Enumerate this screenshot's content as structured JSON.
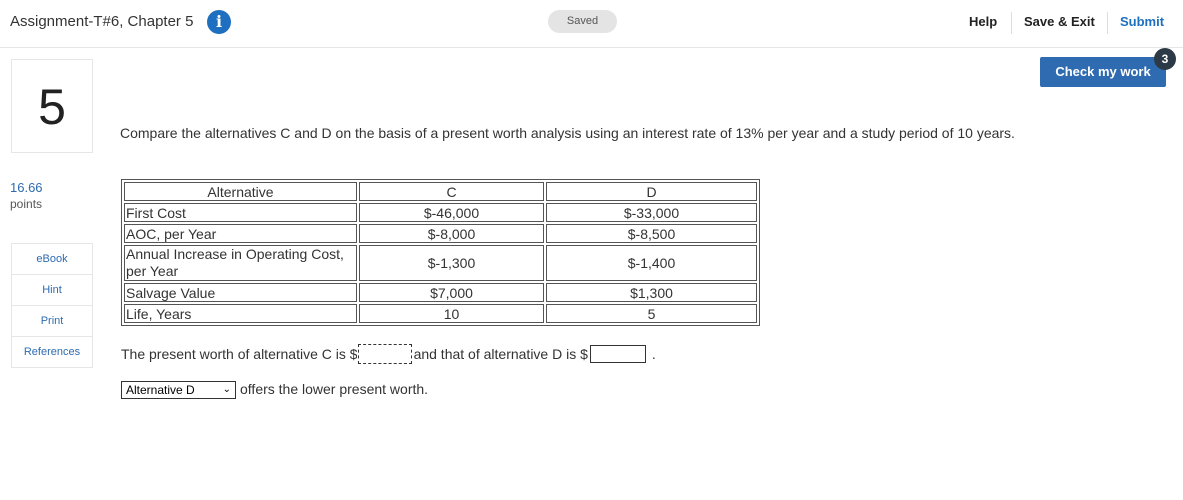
{
  "header": {
    "title": "Assignment-T#6, Chapter 5",
    "info_icon": "info-icon",
    "status": "Saved",
    "help": "Help",
    "save_exit": "Save & Exit",
    "submit": "Submit"
  },
  "check_work": {
    "label": "Check my work",
    "badge": "3"
  },
  "question": {
    "number": "5",
    "points_value": "16.66",
    "points_label": "points",
    "text": "Compare the alternatives C and D on the basis of a present worth analysis using an interest rate of 13% per year and a study period of 10 years."
  },
  "sidebar": {
    "items": [
      {
        "label": "eBook"
      },
      {
        "label": "Hint"
      },
      {
        "label": "Print"
      },
      {
        "label": "References"
      }
    ]
  },
  "table": {
    "headers": [
      "Alternative",
      "C",
      "D"
    ],
    "rows": [
      [
        "First Cost",
        "$-46,000",
        "$-33,000"
      ],
      [
        "AOC, per Year",
        "$-8,000",
        "$-8,500"
      ],
      [
        "Annual Increase in Operating Cost, per Year",
        "$-1,300",
        "$-1,400"
      ],
      [
        "Salvage Value",
        "$7,000",
        "$1,300"
      ],
      [
        "Life, Years",
        "10",
        "5"
      ]
    ]
  },
  "answers": {
    "pw_c_prefix": "The present worth of alternative C is $",
    "pw_c_value": "",
    "pw_d_prefix": "and that of alternative D is $",
    "pw_d_value": "",
    "end": ".",
    "choice_selected": "Alternative D",
    "choice_suffix": "offers the lower present worth."
  },
  "colors": {
    "accent": "#2e6bb0",
    "info_icon": "#1e6fbf",
    "badge": "#2c3a47"
  }
}
